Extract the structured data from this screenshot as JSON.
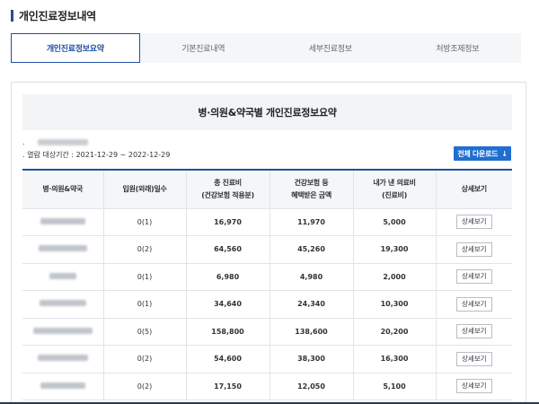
{
  "page": {
    "title": "개인진료정보내역"
  },
  "tabs": [
    {
      "label": "개인진료정보요약",
      "active": true
    },
    {
      "label": "기본진료내역",
      "active": false
    },
    {
      "label": "세부진료정보",
      "active": false
    },
    {
      "label": "처방조제정보",
      "active": false
    }
  ],
  "panel": {
    "heading": "병·의원&약국별 개인진료정보요약",
    "period": ". 열람 대상기간 : 2021-12-29 ~ 2022-12-29",
    "download_label": "전체 다운로드",
    "download_icon": "arrow-down-icon"
  },
  "table": {
    "headers": [
      {
        "line1": "병·의원&약국",
        "line2": ""
      },
      {
        "line1": "입원(외래)일수",
        "line2": ""
      },
      {
        "line1": "총 진료비",
        "line2": "(건강보험 적용분)"
      },
      {
        "line1": "건강보험 등",
        "line2": "혜택받은 금액"
      },
      {
        "line1": "내가 낸 의료비",
        "line2": "(진료비)"
      },
      {
        "line1": "상세보기",
        "line2": ""
      }
    ],
    "detail_label": "상세보기",
    "rows": [
      {
        "days": "0(1)",
        "total": "16,970",
        "benefit": "11,970",
        "paid": "5,000"
      },
      {
        "days": "0(2)",
        "total": "64,560",
        "benefit": "45,260",
        "paid": "19,300"
      },
      {
        "days": "0(1)",
        "total": "6,980",
        "benefit": "4,980",
        "paid": "2,000"
      },
      {
        "days": "0(1)",
        "total": "34,640",
        "benefit": "24,340",
        "paid": "10,300"
      },
      {
        "days": "0(5)",
        "total": "158,800",
        "benefit": "138,600",
        "paid": "20,200"
      },
      {
        "days": "0(2)",
        "total": "54,600",
        "benefit": "38,300",
        "paid": "16,300"
      },
      {
        "days": "0(2)",
        "total": "17,150",
        "benefit": "12,050",
        "paid": "5,100"
      }
    ]
  }
}
